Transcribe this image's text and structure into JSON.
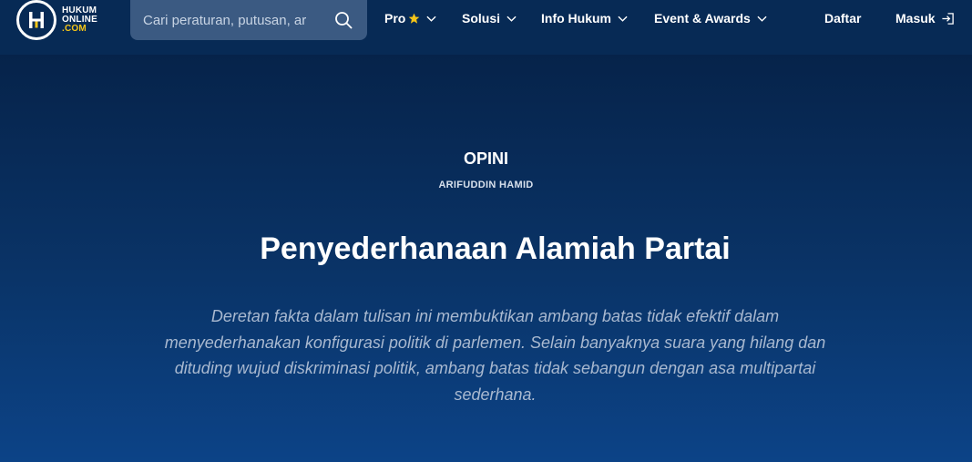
{
  "logo": {
    "line1": "HUKUM",
    "line2": "ONLINE",
    "line3": ".COM"
  },
  "search": {
    "placeholder": "Cari peraturan, putusan, ar"
  },
  "nav": {
    "pro": "Pro",
    "solusi": "Solusi",
    "info_hukum": "Info Hukum",
    "event": "Event & Awards",
    "daftar": "Daftar",
    "masuk": "Masuk"
  },
  "article": {
    "category": "OPINI",
    "author": "ARIFUDDIN HAMID",
    "title": "Penyederhanaan Alamiah Partai",
    "summary": "Deretan fakta dalam tulisan ini membuktikan ambang batas tidak efektif dalam menyederhanakan konfigurasi politik di parlemen. Selain banyaknya suara yang hilang dan dituding wujud diskriminasi politik, ambang batas tidak sebangun dengan asa multipartai sederhana."
  },
  "colors": {
    "accent_star": "#f5c518",
    "nav_bg": "#072a55",
    "search_bg": "#3b5a82"
  }
}
